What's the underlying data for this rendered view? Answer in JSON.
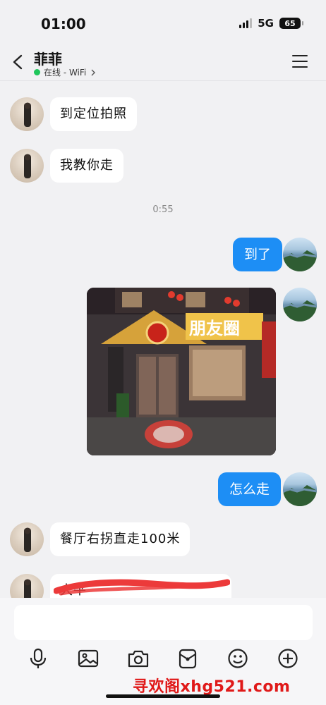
{
  "status_bar": {
    "time": "01:00",
    "network": "5G",
    "battery": "65"
  },
  "header": {
    "contact_name": "菲菲",
    "status": "在线 - WiFi"
  },
  "messages": [
    {
      "side": "left",
      "text": "到定位拍照"
    },
    {
      "side": "left",
      "text": "我教你走"
    },
    {
      "side": "center",
      "text": "0:55"
    },
    {
      "side": "right",
      "text": "到了"
    },
    {
      "side": "right",
      "type": "image",
      "sign_text": "朋友圈"
    },
    {
      "side": "right",
      "text": "怎么走"
    },
    {
      "side": "left",
      "text": "餐厅右拐直走100米"
    },
    {
      "side": "left",
      "text": "大平"
    }
  ],
  "input": {
    "placeholder": ""
  },
  "toolbar": [
    "mic-icon",
    "image-icon",
    "camera-icon",
    "red-packet-icon",
    "emoji-icon",
    "plus-icon"
  ],
  "watermark": "寻欢阁xhg521.com",
  "colors": {
    "bubble_out": "#1d8ef5",
    "bubble_in": "#ffffff",
    "background": "#f1f1f3",
    "online": "#1fc65b"
  }
}
